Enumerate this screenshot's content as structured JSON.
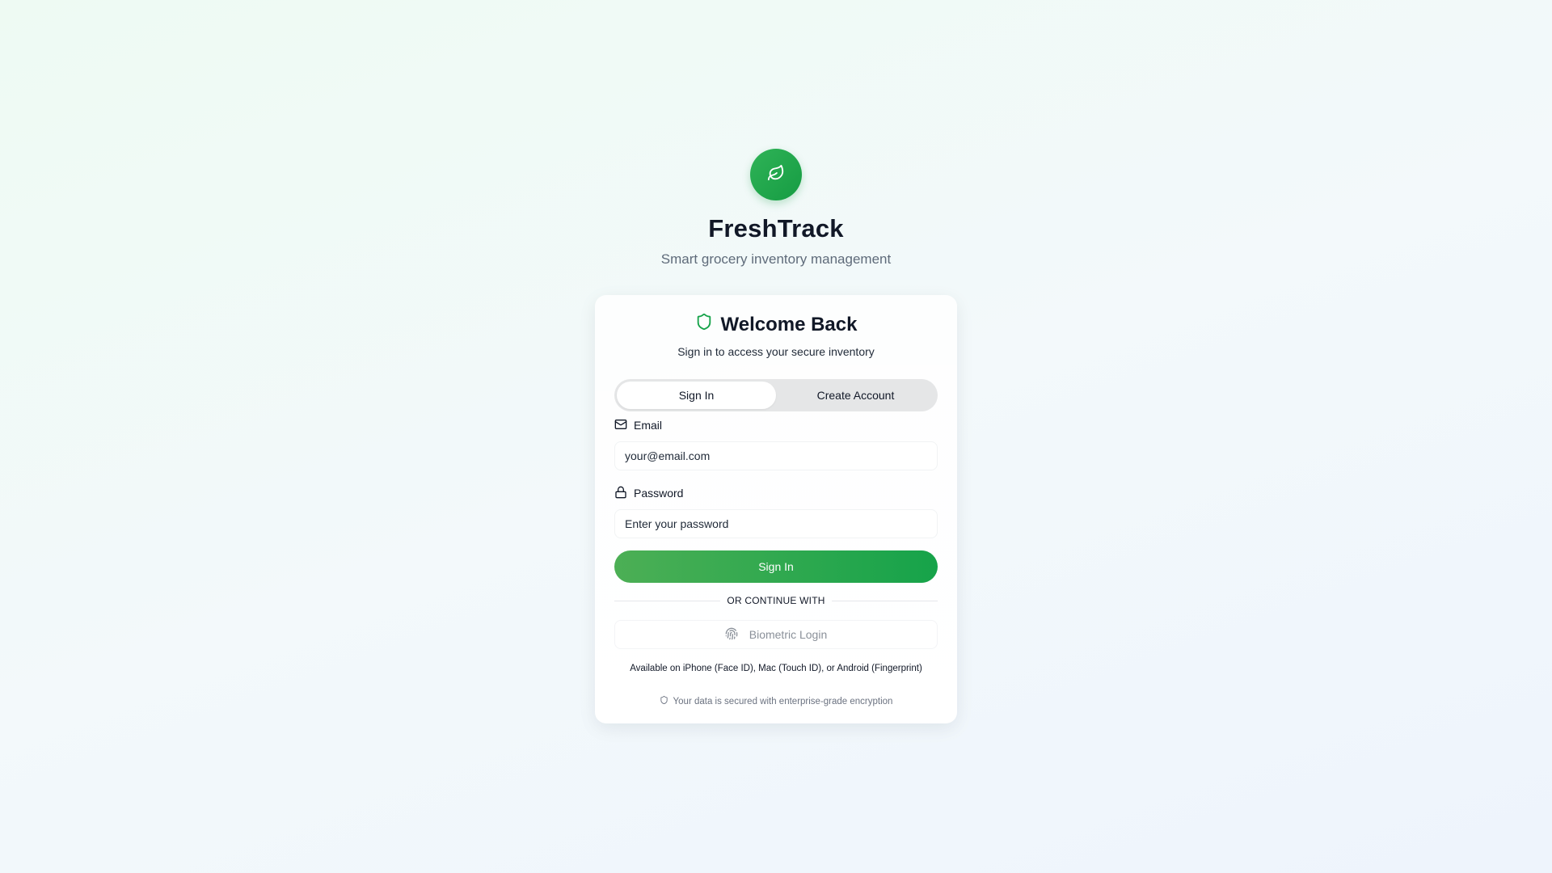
{
  "brand": {
    "logo_icon": "leaf-icon",
    "title": "FreshTrack",
    "subtitle": "Smart grocery inventory management",
    "accent_color": "#16a34a"
  },
  "card": {
    "title_icon": "shield-icon",
    "title": "Welcome Back",
    "subtitle": "Sign in to access your secure inventory",
    "tabs": [
      {
        "label": "Sign In",
        "active": true
      },
      {
        "label": "Create Account",
        "active": false
      }
    ],
    "email": {
      "icon": "mail-icon",
      "label": "Email",
      "placeholder": "your@email.com",
      "value": ""
    },
    "password": {
      "icon": "lock-icon",
      "label": "Password",
      "placeholder": "Enter your password",
      "value": ""
    },
    "submit_label": "Sign In",
    "divider_text": "OR CONTINUE WITH",
    "biometric": {
      "icon": "fingerprint-icon",
      "label": "Biometric Login"
    },
    "availability_note": "Available on iPhone (Face ID), Mac (Touch ID), or Android (Fingerprint)",
    "security_note": {
      "icon": "shield-icon",
      "text": "Your data is secured with enterprise-grade encryption"
    }
  }
}
